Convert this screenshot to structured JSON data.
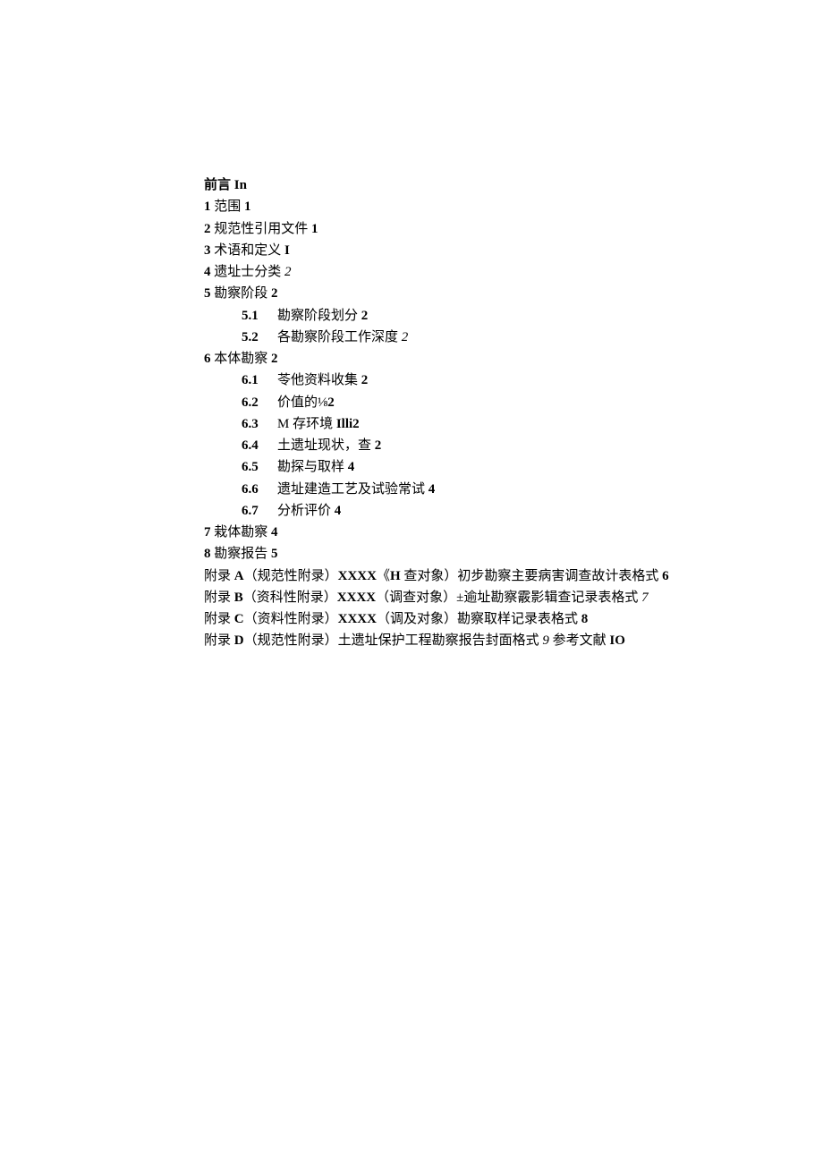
{
  "toc": {
    "l0": [
      {
        "t": "前言 ",
        "b": true
      },
      {
        "t": "In",
        "b": true
      }
    ],
    "l1": [
      {
        "t": "1 ",
        "b": true
      },
      {
        "t": "范围 "
      },
      {
        "t": "1",
        "b": true
      }
    ],
    "l2": [
      {
        "t": "2 ",
        "b": true
      },
      {
        "t": "规范性引用文件 "
      },
      {
        "t": "1",
        "b": true
      }
    ],
    "l3": [
      {
        "t": "3 ",
        "b": true
      },
      {
        "t": "术语和定义 "
      },
      {
        "t": "I",
        "b": true
      }
    ],
    "l4": [
      {
        "t": "4 ",
        "b": true
      },
      {
        "t": "遗址士分类 "
      },
      {
        "t": "2",
        "i": true
      }
    ],
    "l5": [
      {
        "t": "5 ",
        "b": true
      },
      {
        "t": "勘察阶段 "
      },
      {
        "t": "2",
        "b": true
      }
    ],
    "s51": {
      "n": "5.1",
      "t": "勘察阶段划分 ",
      "p": "2",
      "pb": true
    },
    "s52": {
      "n": "5.2",
      "t": "各勘察阶段工作深度 ",
      "p": "2",
      "pi": true
    },
    "l6": [
      {
        "t": "6 ",
        "b": true
      },
      {
        "t": "本体勘察 "
      },
      {
        "t": "2",
        "b": true
      }
    ],
    "s61": {
      "n": "6.1",
      "t": "苓他资料收集 ",
      "p": "2",
      "pb": true
    },
    "s62": {
      "n": "6.2",
      "t": "价值的⅛",
      "p": "2",
      "pb": true
    },
    "s63": {
      "n": "6.3",
      "t": "M 存环境 ",
      "p": "Illi2",
      "pb": true
    },
    "s64": {
      "n": "6.4",
      "t": "土遗址现状，查 ",
      "p": "2",
      "pb": true
    },
    "s65": {
      "n": "6.5",
      "t": "勘探与取样 ",
      "p": "4",
      "pb": true
    },
    "s66": {
      "n": "6.6",
      "t": "遗址建造工艺及试验常试 ",
      "p": "4",
      "pb": true
    },
    "s67": {
      "n": "6.7",
      "t": "分析评价 ",
      "p": "4",
      "pb": true
    },
    "l7": [
      {
        "t": "7 ",
        "b": true
      },
      {
        "t": "栽体勘察 "
      },
      {
        "t": "4",
        "b": true
      }
    ],
    "l8": [
      {
        "t": "8 ",
        "b": true
      },
      {
        "t": "勘察报告 "
      },
      {
        "t": "5",
        "b": true
      }
    ],
    "la": [
      {
        "t": "附录 "
      },
      {
        "t": "A",
        "b": true
      },
      {
        "t": "（规范性附录）"
      },
      {
        "t": "XXXX",
        "b": true
      },
      {
        "t": "《"
      },
      {
        "t": "H ",
        "b": true
      },
      {
        "t": "查对象）初步勘察主要病害调查故计表格式 "
      },
      {
        "t": "6",
        "b": true
      }
    ],
    "lb": [
      {
        "t": "附录 "
      },
      {
        "t": "B",
        "b": true
      },
      {
        "t": "（资科性附录）"
      },
      {
        "t": "XXXX",
        "b": true
      },
      {
        "t": "（调查对象）±逾址勘察霰影辑查记录表格式 "
      },
      {
        "t": "7",
        "i": true
      }
    ],
    "lc": [
      {
        "t": "附录 "
      },
      {
        "t": "C",
        "b": true
      },
      {
        "t": "（资料性附录）"
      },
      {
        "t": "XXXX",
        "b": true
      },
      {
        "t": "（调及对象）勘察取样记录表格式 "
      },
      {
        "t": "8",
        "b": true
      }
    ],
    "ld": [
      {
        "t": "附录 "
      },
      {
        "t": "D",
        "b": true
      },
      {
        "t": "（规范性附录）土遗址保护工程勘察报告封面格式 "
      },
      {
        "t": "9 ",
        "i": true
      },
      {
        "t": "参考文献 "
      },
      {
        "t": "IO",
        "b": true
      }
    ]
  }
}
